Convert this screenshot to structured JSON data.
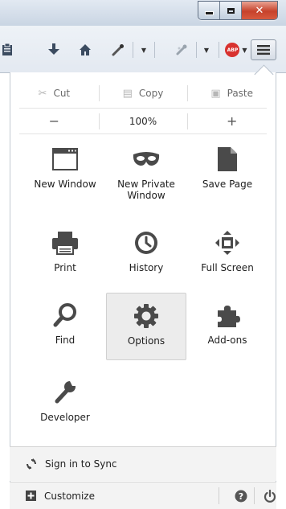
{
  "edit": {
    "cut": "Cut",
    "copy": "Copy",
    "paste": "Paste"
  },
  "zoom": {
    "out": "−",
    "level": "100%",
    "in": "+"
  },
  "tiles": {
    "new_window": "New Window",
    "new_private_window_1": "New Private",
    "new_private_window_2": "Window",
    "save_page": "Save Page",
    "print": "Print",
    "history": "History",
    "full_screen": "Full Screen",
    "find": "Find",
    "options": "Options",
    "addons": "Add-ons",
    "developer": "Developer"
  },
  "footer": {
    "sign_in_sync": "Sign in to Sync",
    "customize": "Customize"
  },
  "toolbar": {
    "abp_label": "ABP"
  },
  "icons": {
    "toolbar": [
      "clipboard-icon",
      "download-icon",
      "home-icon",
      "eyedropper-icon",
      "addon-icon",
      "adblock-icon",
      "hamburger-menu-icon"
    ],
    "window_controls": [
      "minimize-icon",
      "maximize-icon",
      "close-icon"
    ]
  },
  "colors": {
    "selected_tile": "#ececec",
    "close_button": "#c6422b",
    "abp_red": "#d8322f",
    "icon_dark": "#4a4a4a"
  }
}
